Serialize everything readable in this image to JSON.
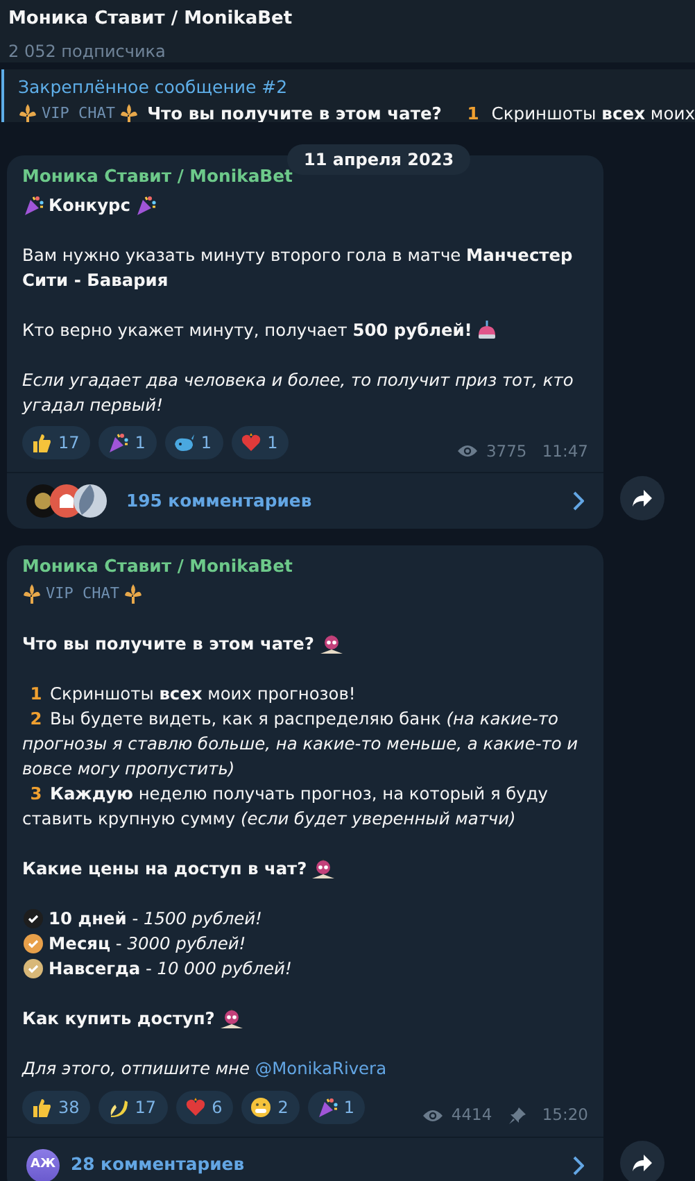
{
  "header": {
    "title": "Моника Ставит / MonikaBet",
    "subtitle": "2 052 подписчика"
  },
  "pinned": {
    "label": "Закреплённое сообщение #2",
    "vip": "VIP  CHAT",
    "question": "Что вы получите в этом чате?",
    "num": "1",
    "text": "Скриншоты **всех** моих"
  },
  "date": "11 апреля 2023",
  "posts": [
    {
      "author": "Моника Ставит / MonikaBet",
      "pinned": false,
      "lines": [
        {
          "kind": "title",
          "text": "Конкурс"
        },
        {
          "kind": "gap"
        },
        {
          "kind": "text",
          "text": "Вам нужно указать минуту второго гола в матче **Манчестер Сити - Бавария**"
        },
        {
          "kind": "gap"
        },
        {
          "kind": "prize",
          "text": "Кто верно укажет минуту, получает **500 рублей!**"
        },
        {
          "kind": "gap"
        },
        {
          "kind": "note",
          "text": "Если угадает два человека и более, то получит приз тот, кто угадал первый!"
        }
      ],
      "reactions": [
        {
          "kind": "thumb",
          "count": "17"
        },
        {
          "kind": "popper",
          "count": "1"
        },
        {
          "kind": "whale",
          "count": "1"
        },
        {
          "kind": "heart",
          "count": "1"
        }
      ],
      "views": "3775",
      "time": "11:47",
      "avatars": [
        {
          "kind": "crest"
        },
        {
          "kind": "ghost"
        },
        {
          "kind": "shade"
        }
      ],
      "comments": "195 комментариев"
    },
    {
      "author": "Моника Ставит / MonikaBet",
      "pinned": true,
      "lines": [
        {
          "kind": "vip",
          "text": "VIP  CHAT"
        },
        {
          "kind": "gap"
        },
        {
          "kind": "question",
          "text": "Что вы получите в этом чате?"
        },
        {
          "kind": "gap"
        },
        {
          "kind": "num",
          "num": "1",
          "text": "Скриншоты **всех** моих прогнозов!"
        },
        {
          "kind": "num",
          "num": "2",
          "text": "Вы будете видеть, как я распределяю банк *(на какие-то прогнозы я ставлю больше, на какие-то меньше, а какие-то и вовсе могу пропустить)*"
        },
        {
          "kind": "num",
          "num": "3",
          "text": "**Каждую** неделю получать прогноз, на который я буду ставить крупную сумму *(если будет уверенный матчи)*"
        },
        {
          "kind": "gap"
        },
        {
          "kind": "question",
          "text": "Какие цены на доступ в чат?"
        },
        {
          "kind": "gap"
        },
        {
          "kind": "price",
          "color": "#1e1e1e",
          "text": "**10 дней** - *1500 рублей!*"
        },
        {
          "kind": "price",
          "color": "#e8a04a",
          "text": "**Месяц** - *3000 рублей!*"
        },
        {
          "kind": "price",
          "color": "#d8b878",
          "text": "**Навсегда** - *10 000 рублей!*"
        },
        {
          "kind": "gap"
        },
        {
          "kind": "question",
          "text": "Как купить доступ?"
        },
        {
          "kind": "gap"
        },
        {
          "kind": "contact",
          "text": "Для этого, отпишите мне",
          "link": "@MonikaRivera"
        }
      ],
      "reactions": [
        {
          "kind": "thumb",
          "count": "38"
        },
        {
          "kind": "banana",
          "count": "17"
        },
        {
          "kind": "heart",
          "count": "6"
        },
        {
          "kind": "grin",
          "count": "2"
        },
        {
          "kind": "popper",
          "count": "1"
        }
      ],
      "views": "4414",
      "time": "15:20",
      "avatars": [
        {
          "kind": "initials",
          "text": "АЖ"
        }
      ],
      "comments": "28 комментариев"
    }
  ]
}
